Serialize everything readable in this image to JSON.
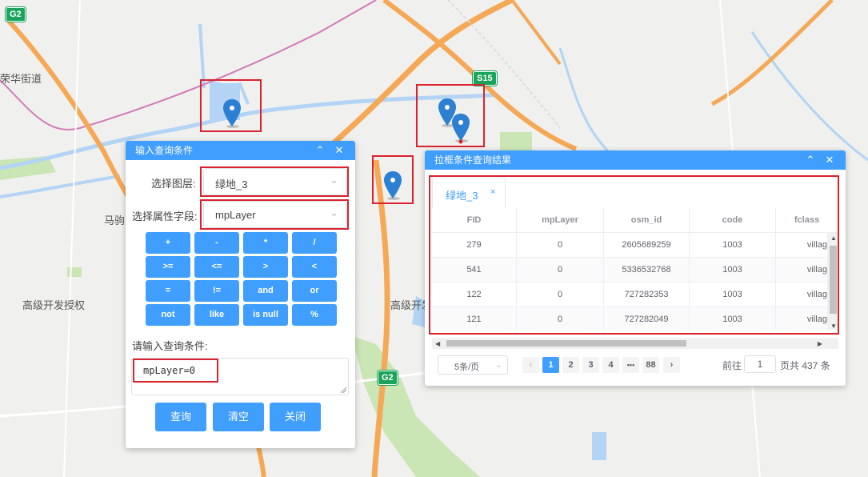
{
  "map": {
    "labels": [
      "荣华街道",
      "马驹",
      "高级开发授权",
      "高级开发"
    ],
    "shields": [
      "G2",
      "S15",
      "G2"
    ],
    "colors": {
      "road": "#f5a855",
      "water": "#a9cdf2",
      "green": "#b7dea3",
      "rail": "#d37ab6",
      "land": "#f0f0ee"
    }
  },
  "query_panel": {
    "title": "输入查询条件",
    "collapse_icon": "chevron-up-icon",
    "close_icon": "close-icon",
    "layer_label": "选择图层:",
    "layer_value": "绿地_3",
    "field_label": "选择属性字段:",
    "field_value": "mpLayer",
    "operators": [
      "+",
      "-",
      "*",
      "/",
      ">=",
      "<=",
      ">",
      "<",
      "=",
      "!=",
      "and",
      "or",
      "not",
      "like",
      "is null",
      "%"
    ],
    "condition_label": "请输入查询条件:",
    "condition_value": "mpLayer=0",
    "btn_query": "查询",
    "btn_clear": "清空",
    "btn_close": "关闭"
  },
  "result_panel": {
    "title": "拉框条件查询结果",
    "tab_label": "绿地_3",
    "tab_close": "×",
    "columns": [
      "FID",
      "mpLayer",
      "osm_id",
      "code",
      "fclass"
    ],
    "rows": [
      [
        "279",
        "0",
        "2605689259",
        "1003",
        "villag"
      ],
      [
        "541",
        "0",
        "5336532768",
        "1003",
        "villag"
      ],
      [
        "122",
        "0",
        "727282353",
        "1003",
        "villag"
      ],
      [
        "121",
        "0",
        "727282049",
        "1003",
        "villag"
      ]
    ],
    "pagination": {
      "page_size": "5条/页",
      "pages": [
        "1",
        "2",
        "3",
        "4",
        "•••",
        "88"
      ],
      "active_page": "1",
      "goto_label": "前往",
      "goto_value": "1",
      "total_text": "页共 437 条"
    }
  },
  "accent_color": "#409eff",
  "highlight_color": "#d9232e"
}
